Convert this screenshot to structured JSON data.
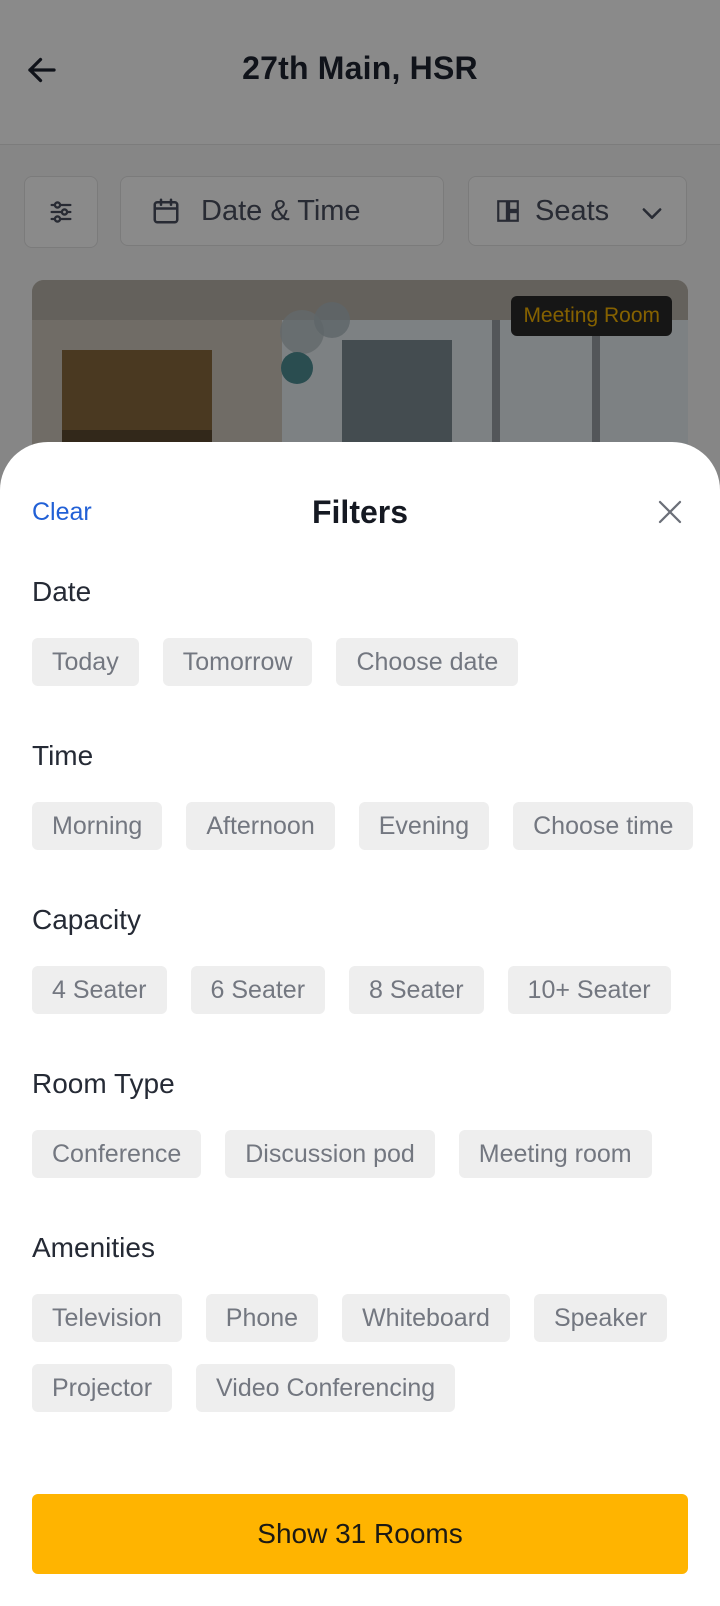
{
  "header": {
    "title": "27th Main, HSR",
    "back_icon": "arrow-left-icon"
  },
  "toolbar": {
    "filters_icon": "sliders-icon",
    "date_time_label": "Date & Time",
    "date_time_icon": "calendar-icon",
    "seats_label": "Seats",
    "seats_icon": "grid-icon",
    "seats_chevron_icon": "chevron-down-icon"
  },
  "room_card": {
    "badge": "Meeting Room"
  },
  "filters_sheet": {
    "clear_label": "Clear",
    "title": "Filters",
    "close_icon": "close-icon",
    "sections": [
      {
        "label": "Date",
        "options": [
          "Today",
          "Tomorrow",
          "Choose date"
        ]
      },
      {
        "label": "Time",
        "options": [
          "Morning",
          "Afternoon",
          "Evening",
          "Choose time"
        ]
      },
      {
        "label": "Capacity",
        "options": [
          "4 Seater",
          "6 Seater",
          "8 Seater",
          "10+ Seater"
        ]
      },
      {
        "label": "Room Type",
        "options": [
          "Conference",
          "Discussion pod",
          "Meeting room"
        ]
      },
      {
        "label": "Amenities",
        "options": [
          "Television",
          "Phone",
          "Whiteboard",
          "Speaker",
          "Projector",
          "Video Conferencing"
        ]
      }
    ],
    "cta_label": "Show 31 Rooms"
  },
  "colors": {
    "accent": "#ffb400",
    "link": "#2160d6",
    "chip_bg": "#eeeeee",
    "chip_text": "#737780",
    "badge_text": "#f5b400"
  }
}
